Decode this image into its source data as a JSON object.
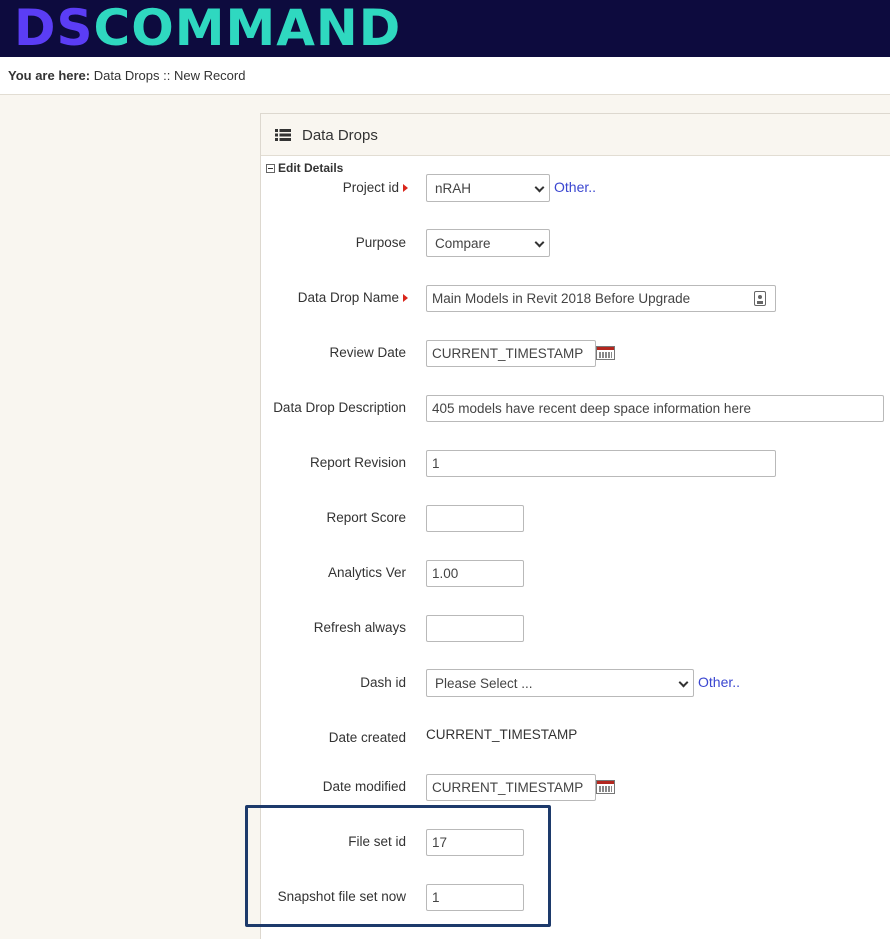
{
  "app": {
    "logo_part1": "DS",
    "logo_part2": "COMMAND"
  },
  "breadcrumb": {
    "prefix": "You are here:",
    "path": "Data Drops :: New Record"
  },
  "panel": {
    "title": "Data Drops",
    "section": "Edit Details",
    "icon": "list-icon"
  },
  "form": {
    "project_id": {
      "label": "Project id",
      "value": "nRAH",
      "other": "Other.."
    },
    "purpose": {
      "label": "Purpose",
      "value": "Compare"
    },
    "data_drop_name": {
      "label": "Data Drop Name",
      "value": "Main Models in Revit 2018 Before Upgrade"
    },
    "review_date": {
      "label": "Review Date",
      "value": "CURRENT_TIMESTAMP"
    },
    "description": {
      "label": "Data Drop Description",
      "value": "405 models have recent deep space information here"
    },
    "report_revision": {
      "label": "Report Revision",
      "value": "1"
    },
    "report_score": {
      "label": "Report Score",
      "value": ""
    },
    "analytics_ver": {
      "label": "Analytics Ver",
      "value": "1.00"
    },
    "refresh_always": {
      "label": "Refresh always",
      "value": ""
    },
    "dash_id": {
      "label": "Dash id",
      "value": "Please Select ...",
      "other": "Other.."
    },
    "date_created": {
      "label": "Date created",
      "value": "CURRENT_TIMESTAMP"
    },
    "date_modified": {
      "label": "Date modified",
      "value": "CURRENT_TIMESTAMP"
    },
    "file_set_id": {
      "label": "File set id",
      "value": "17"
    },
    "snapshot_file_set_now": {
      "label": "Snapshot file set now",
      "value": "1"
    }
  },
  "colors": {
    "header_bg": "#0d0b3e",
    "logo_ds": "#5b3df5",
    "logo_command": "#2fd8c0",
    "link": "#3a46d0",
    "highlight_border": "#1d3a6b"
  }
}
